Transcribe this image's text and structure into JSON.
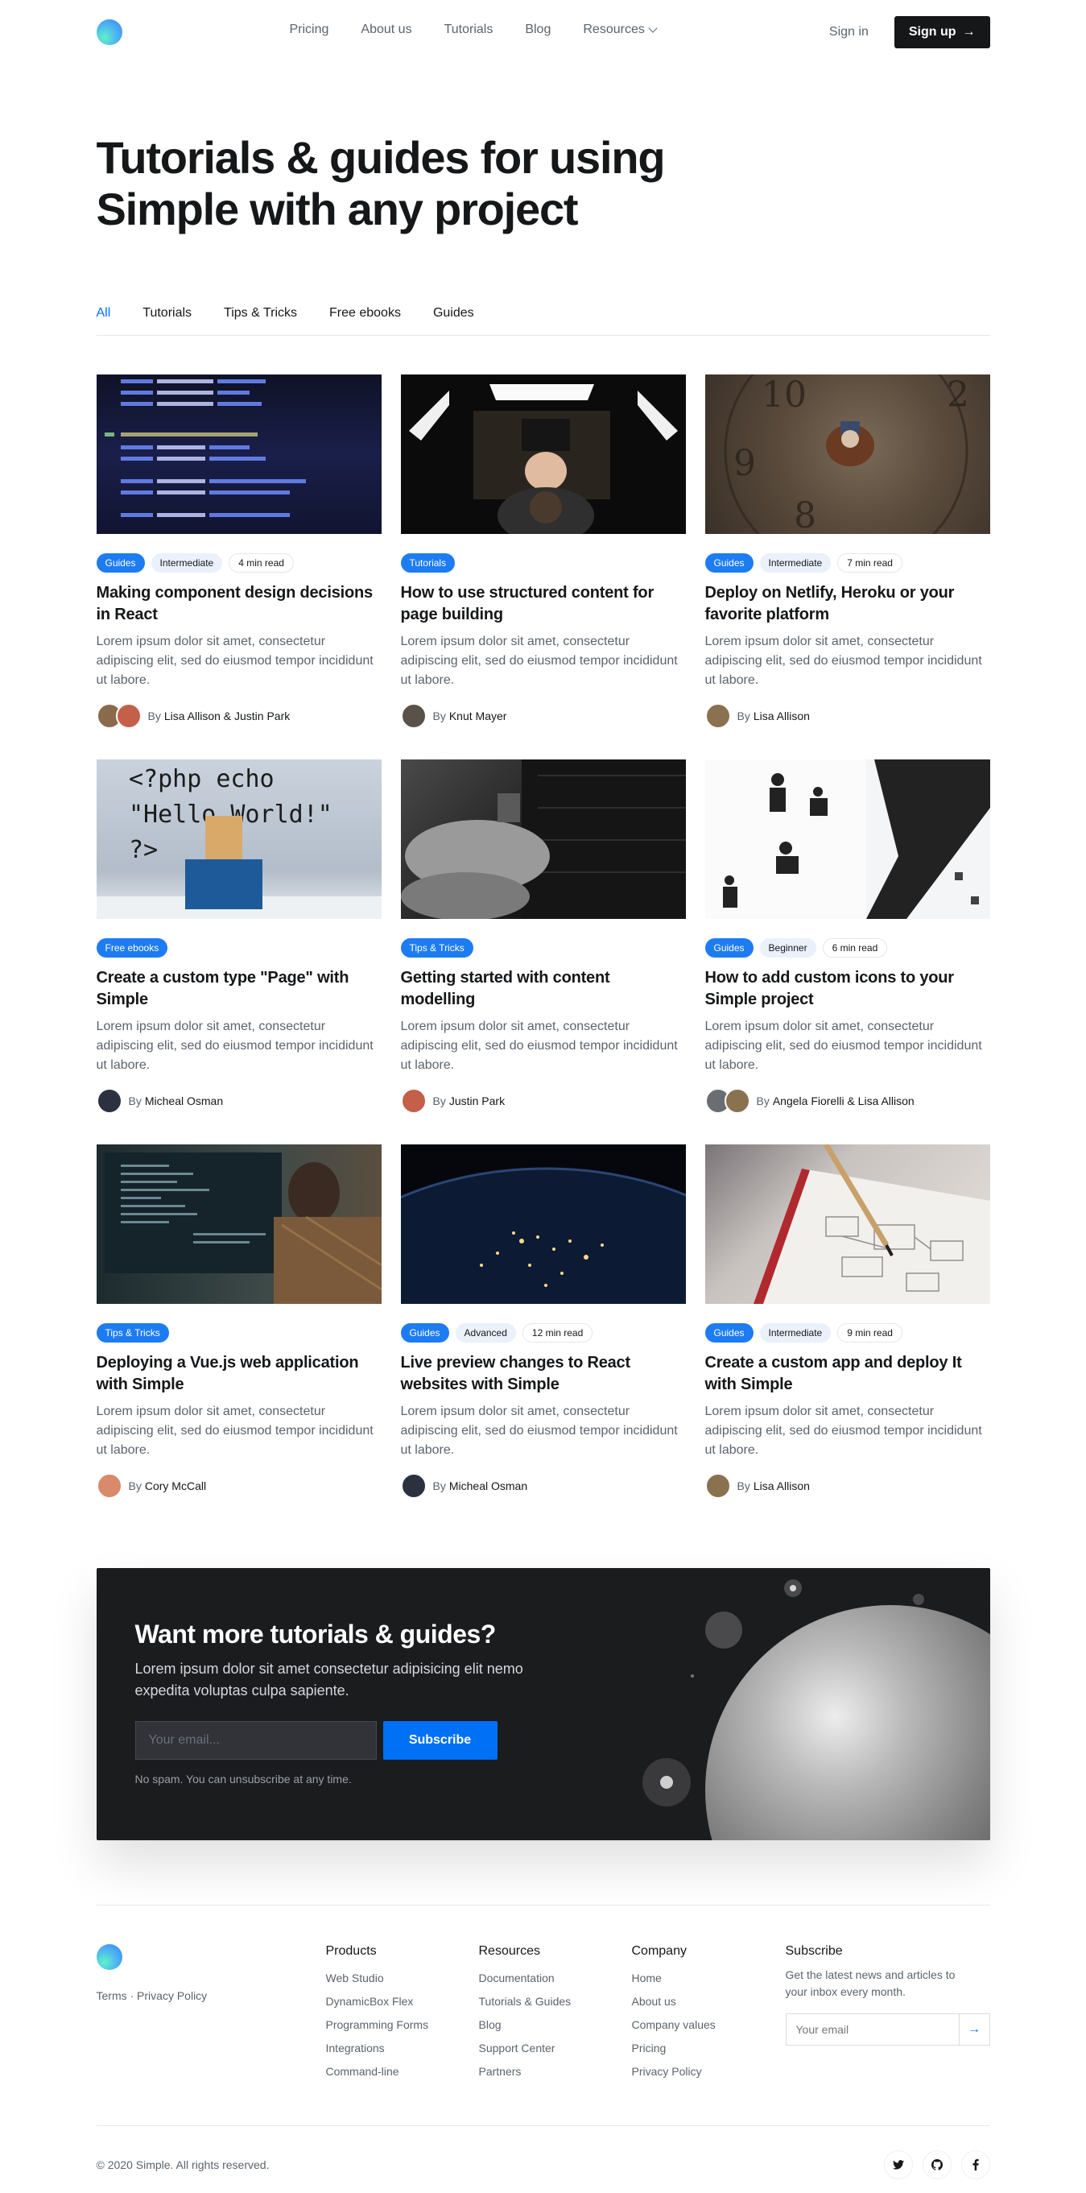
{
  "header": {
    "nav": [
      "Pricing",
      "About us",
      "Tutorials",
      "Blog",
      "Resources"
    ],
    "signin": "Sign in",
    "signup": "Sign up"
  },
  "hero": {
    "title": "Tutorials & guides for using Simple with any project"
  },
  "tabs": [
    "All",
    "Tutorials",
    "Tips & Tricks",
    "Free ebooks",
    "Guides"
  ],
  "articles": [
    {
      "tags": [
        "Guides",
        "Intermediate",
        "4 min read"
      ],
      "title": "Making component design decisions in React",
      "excerpt": "Lorem ipsum dolor sit amet, consectetur adipiscing elit, sed do eiusmod tempor incididunt ut labore.",
      "by": "By",
      "author": "Lisa Allison & Justin Park"
    },
    {
      "tags": [
        "Tutorials"
      ],
      "title": "How to use structured content for page building",
      "excerpt": "Lorem ipsum dolor sit amet, consectetur adipiscing elit, sed do eiusmod tempor incididunt ut labore.",
      "by": "By",
      "author": "Knut Mayer"
    },
    {
      "tags": [
        "Guides",
        "Intermediate",
        "7 min read"
      ],
      "title": "Deploy on Netlify, Heroku or your favorite platform",
      "excerpt": "Lorem ipsum dolor sit amet, consectetur adipiscing elit, sed do eiusmod tempor incididunt ut labore.",
      "by": "By",
      "author": "Lisa Allison"
    },
    {
      "tags": [
        "Free ebooks"
      ],
      "title": "Create a custom type \"Page\" with Simple",
      "excerpt": "Lorem ipsum dolor sit amet, consectetur adipiscing elit, sed do eiusmod tempor incididunt ut labore.",
      "by": "By",
      "author": "Micheal Osman"
    },
    {
      "tags": [
        "Tips & Tricks"
      ],
      "title": "Getting started with content modelling",
      "excerpt": "Lorem ipsum dolor sit amet, consectetur adipiscing elit, sed do eiusmod tempor incididunt ut labore.",
      "by": "By",
      "author": "Justin Park"
    },
    {
      "tags": [
        "Guides",
        "Beginner",
        "6 min read"
      ],
      "title": "How to add custom icons to your Simple project",
      "excerpt": "Lorem ipsum dolor sit amet, consectetur adipiscing elit, sed do eiusmod tempor incididunt ut labore.",
      "by": "By",
      "author": "Angela Fiorelli & Lisa Allison"
    },
    {
      "tags": [
        "Tips & Tricks"
      ],
      "title": "Deploying a Vue.js web application with Simple",
      "excerpt": "Lorem ipsum dolor sit amet, consectetur adipiscing elit, sed do eiusmod tempor incididunt ut labore.",
      "by": "By",
      "author": "Cory McCall"
    },
    {
      "tags": [
        "Guides",
        "Advanced",
        "12 min read"
      ],
      "title": "Live preview changes to React websites with Simple",
      "excerpt": "Lorem ipsum dolor sit amet, consectetur adipiscing elit, sed do eiusmod tempor incididunt ut labore.",
      "by": "By",
      "author": "Micheal Osman"
    },
    {
      "tags": [
        "Guides",
        "Intermediate",
        "9 min read"
      ],
      "title": "Create a custom app and deploy It with Simple",
      "excerpt": "Lorem ipsum dolor sit amet, consectetur adipiscing elit, sed do eiusmod tempor incididunt ut labore.",
      "by": "By",
      "author": "Lisa Allison"
    }
  ],
  "cta": {
    "title": "Want more tutorials & guides?",
    "subtitle": "Lorem ipsum dolor sit amet consectetur adipisicing elit nemo expedita voluptas culpa sapiente.",
    "email_placeholder": "Your email...",
    "button": "Subscribe",
    "note": "No spam. You can unsubscribe at any time."
  },
  "footer": {
    "legal": "Terms · Privacy Policy",
    "columns": [
      {
        "title": "Products",
        "links": [
          "Web Studio",
          "DynamicBox Flex",
          "Programming Forms",
          "Integrations",
          "Command-line"
        ]
      },
      {
        "title": "Resources",
        "links": [
          "Documentation",
          "Tutorials & Guides",
          "Blog",
          "Support Center",
          "Partners"
        ]
      },
      {
        "title": "Company",
        "links": [
          "Home",
          "About us",
          "Company values",
          "Pricing",
          "Privacy Policy"
        ]
      }
    ],
    "subscribe_title": "Subscribe",
    "subscribe_text": "Get the latest news and articles to your inbox every month.",
    "subscribe_placeholder": "Your email",
    "copyright": "© 2020 Simple. All rights reserved.",
    "socials": [
      "twitter-icon",
      "github-icon",
      "facebook-icon"
    ]
  },
  "colors": {
    "accent": "#0070f4",
    "tag_blue": "#1d7cf2",
    "dark": "#151719",
    "cta_bg": "#1b1c1e"
  }
}
